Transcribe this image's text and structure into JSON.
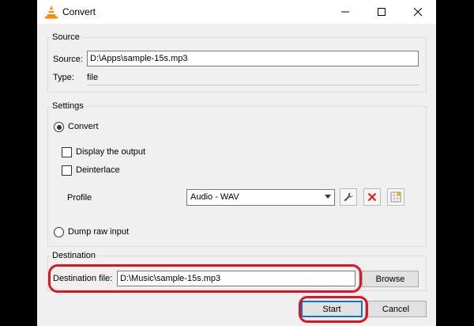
{
  "window": {
    "title": "Convert"
  },
  "source": {
    "group_label": "Source",
    "source_label": "Source:",
    "source_value": "D:\\Apps\\sample-15s.mp3",
    "type_label": "Type:",
    "type_value": "file"
  },
  "settings": {
    "group_label": "Settings",
    "convert_label": "Convert",
    "display_output_label": "Display the output",
    "deinterlace_label": "Deinterlace",
    "profile_label": "Profile",
    "profile_value": "Audio - WAV",
    "dump_raw_label": "Dump raw input"
  },
  "destination": {
    "group_label": "Destination",
    "file_label": "Destination file:",
    "file_value": "D:\\Music\\sample-15s.mp3",
    "browse_label": "Browse"
  },
  "actions": {
    "start_label": "Start",
    "cancel_label": "Cancel"
  },
  "colors": {
    "highlight": "#e0141e",
    "accent": "#0078d7"
  }
}
